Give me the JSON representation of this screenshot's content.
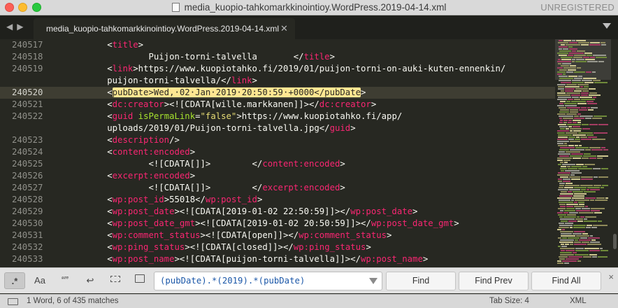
{
  "window": {
    "title": "media_kuopio-tahkomarkkinointioy.WordPress.2019-04-14.xml",
    "registration": "UNREGISTERED"
  },
  "tabs": [
    {
      "label": "media_kuopio-tahkomarkkinointioy.WordPress.2019-04-14.xml",
      "active": true
    }
  ],
  "editor": {
    "current_line": "240520",
    "gutter": [
      "240517",
      "240518",
      "240519",
      "",
      "240520",
      "240521",
      "240522",
      "",
      "240523",
      "240524",
      "240525",
      "240526",
      "240527",
      "240528",
      "240529",
      "240530",
      "240531",
      "240532",
      "240533"
    ],
    "lines": [
      [
        {
          "t": "        <",
          "c": "p"
        },
        {
          "t": "title",
          "c": "tg"
        },
        {
          "t": ">",
          "c": "p"
        }
      ],
      [
        {
          "t": "                Puijon-torni-talvella       </",
          "c": "p"
        },
        {
          "t": "title",
          "c": "tg"
        },
        {
          "t": ">",
          "c": "p"
        }
      ],
      [
        {
          "t": "        <",
          "c": "p"
        },
        {
          "t": "link",
          "c": "tg"
        },
        {
          "t": ">https://www.kuopiotahko.fi/2019/01/puijon-torni-on-auki-kuten-ennenkin/",
          "c": "p"
        }
      ],
      [
        {
          "t": "        puijon-torni-talvella/</",
          "c": "p"
        },
        {
          "t": "link",
          "c": "tg"
        },
        {
          "t": ">",
          "c": "p"
        }
      ],
      [
        {
          "t": "        <",
          "c": "p"
        },
        {
          "t": "pubDate>Wed,·02·Jan·2019·20:50:59·+0000</pubDate",
          "c": "hl"
        },
        {
          "t": ">",
          "c": "p"
        }
      ],
      [
        {
          "t": "        <",
          "c": "p"
        },
        {
          "t": "dc:creator",
          "c": "tg"
        },
        {
          "t": "><![CDATA[wille.markkanen]]></",
          "c": "p"
        },
        {
          "t": "dc:creator",
          "c": "tg"
        },
        {
          "t": ">",
          "c": "p"
        }
      ],
      [
        {
          "t": "        <",
          "c": "p"
        },
        {
          "t": "guid",
          "c": "tg"
        },
        {
          "t": " ",
          "c": "p"
        },
        {
          "t": "isPermaLink",
          "c": "at"
        },
        {
          "t": "=",
          "c": "p"
        },
        {
          "t": "\"false\"",
          "c": "st"
        },
        {
          "t": ">https://www.kuopiotahko.fi/app/",
          "c": "p"
        }
      ],
      [
        {
          "t": "        uploads/2019/01/Puijon-torni-talvella.jpg</",
          "c": "p"
        },
        {
          "t": "guid",
          "c": "tg"
        },
        {
          "t": ">",
          "c": "p"
        }
      ],
      [
        {
          "t": "        <",
          "c": "p"
        },
        {
          "t": "description",
          "c": "tg"
        },
        {
          "t": "/>",
          "c": "p"
        }
      ],
      [
        {
          "t": "        <",
          "c": "p"
        },
        {
          "t": "content:encoded",
          "c": "tg"
        },
        {
          "t": ">",
          "c": "p"
        }
      ],
      [
        {
          "t": "                <![CDATA[]]>        </",
          "c": "p"
        },
        {
          "t": "content:encoded",
          "c": "tg"
        },
        {
          "t": ">",
          "c": "p"
        }
      ],
      [
        {
          "t": "        <",
          "c": "p"
        },
        {
          "t": "excerpt:encoded",
          "c": "tg"
        },
        {
          "t": ">",
          "c": "p"
        }
      ],
      [
        {
          "t": "                <![CDATA[]]>        </",
          "c": "p"
        },
        {
          "t": "excerpt:encoded",
          "c": "tg"
        },
        {
          "t": ">",
          "c": "p"
        }
      ],
      [
        {
          "t": "        <",
          "c": "p"
        },
        {
          "t": "wp:post_id",
          "c": "tg"
        },
        {
          "t": ">55018</",
          "c": "p"
        },
        {
          "t": "wp:post_id",
          "c": "tg"
        },
        {
          "t": ">",
          "c": "p"
        }
      ],
      [
        {
          "t": "        <",
          "c": "p"
        },
        {
          "t": "wp:post_date",
          "c": "tg"
        },
        {
          "t": "><![CDATA[2019-01-02 22:50:59]]></",
          "c": "p"
        },
        {
          "t": "wp:post_date",
          "c": "tg"
        },
        {
          "t": ">",
          "c": "p"
        }
      ],
      [
        {
          "t": "        <",
          "c": "p"
        },
        {
          "t": "wp:post_date_gmt",
          "c": "tg"
        },
        {
          "t": "><![CDATA[2019-01-02 20:50:59]]></",
          "c": "p"
        },
        {
          "t": "wp:post_date_gmt",
          "c": "tg"
        },
        {
          "t": ">",
          "c": "p"
        }
      ],
      [
        {
          "t": "        <",
          "c": "p"
        },
        {
          "t": "wp:comment_status",
          "c": "tg"
        },
        {
          "t": "><![CDATA[open]]></",
          "c": "p"
        },
        {
          "t": "wp:comment_status",
          "c": "tg"
        },
        {
          "t": ">",
          "c": "p"
        }
      ],
      [
        {
          "t": "        <",
          "c": "p"
        },
        {
          "t": "wp:ping_status",
          "c": "tg"
        },
        {
          "t": "><![CDATA[closed]]></",
          "c": "p"
        },
        {
          "t": "wp:ping_status",
          "c": "tg"
        },
        {
          "t": ">",
          "c": "p"
        }
      ],
      [
        {
          "t": "        <",
          "c": "p"
        },
        {
          "t": "wp:post_name",
          "c": "tg"
        },
        {
          "t": "><![CDATA[puijon-torni-talvella]]></",
          "c": "p"
        },
        {
          "t": "wp:post_name",
          "c": "tg"
        },
        {
          "t": ">",
          "c": "p"
        }
      ]
    ]
  },
  "find": {
    "regex_label": ".*",
    "case_label": "Aa",
    "whole_word_label": "“”",
    "query": "(pubDate).*(2019).*(pubDate)",
    "find_label": "Find",
    "find_prev_label": "Find Prev",
    "find_all_label": "Find All",
    "close_label": "×"
  },
  "status": {
    "matches": "1 Word, 6 of 435 matches",
    "tab_size": "Tab Size: 4",
    "syntax": "XML"
  },
  "colors": {
    "editor_bg": "#272822",
    "tag": "#f92672",
    "string": "#e6db74",
    "attribute": "#a6e22e",
    "highlight": "#ffe792"
  }
}
